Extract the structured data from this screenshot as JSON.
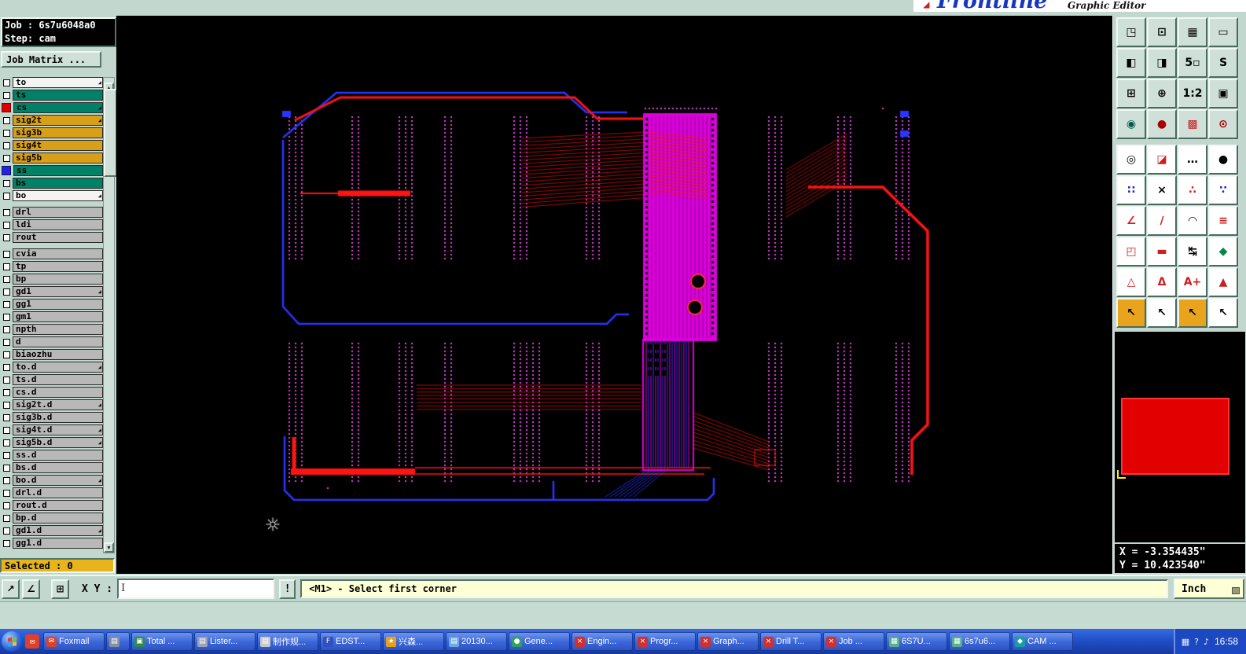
{
  "window": {
    "brand": "Frontline",
    "brand_sub": "Graphic Editor"
  },
  "job_panel": {
    "job_label": "Job : 6s7u6048a0",
    "step_label": "Step: cam",
    "matrix_button": "Job Matrix ..."
  },
  "layers": {
    "selected_label": "Selected : 0",
    "items": [
      {
        "name": "to",
        "color": "white",
        "arrow": true
      },
      {
        "name": "ts",
        "color": "teal"
      },
      {
        "name": "cs",
        "color": "teal",
        "indicator": "red",
        "arrow": true
      },
      {
        "name": "sig2t",
        "color": "gold",
        "arrow": true
      },
      {
        "name": "sig3b",
        "color": "gold"
      },
      {
        "name": "sig4t",
        "color": "gold"
      },
      {
        "name": "sig5b",
        "color": "gold"
      },
      {
        "name": "ss",
        "color": "teal",
        "indicator": "blue"
      },
      {
        "name": "bs",
        "color": "teal"
      },
      {
        "name": "bo",
        "color": "white",
        "arrow": true
      },
      {
        "name": "drl",
        "color": "gray",
        "gap": true
      },
      {
        "name": "ldi",
        "color": "gray"
      },
      {
        "name": "rout",
        "color": "gray"
      },
      {
        "name": "cvia",
        "color": "gray",
        "gap": true
      },
      {
        "name": "tp",
        "color": "gray"
      },
      {
        "name": "bp",
        "color": "gray"
      },
      {
        "name": "gd1",
        "color": "gray",
        "arrow": true
      },
      {
        "name": "gg1",
        "color": "gray"
      },
      {
        "name": "gm1",
        "color": "gray"
      },
      {
        "name": "npth",
        "color": "gray"
      },
      {
        "name": "d",
        "color": "gray"
      },
      {
        "name": "biaozhu",
        "color": "gray"
      },
      {
        "name": "to.d",
        "color": "gray",
        "arrow": true
      },
      {
        "name": "ts.d",
        "color": "gray"
      },
      {
        "name": "cs.d",
        "color": "gray"
      },
      {
        "name": "sig2t.d",
        "color": "gray",
        "arrow": true
      },
      {
        "name": "sig3b.d",
        "color": "gray"
      },
      {
        "name": "sig4t.d",
        "color": "gray",
        "arrow": true
      },
      {
        "name": "sig5b.d",
        "color": "gray",
        "arrow": true
      },
      {
        "name": "ss.d",
        "color": "gray"
      },
      {
        "name": "bs.d",
        "color": "gray"
      },
      {
        "name": "bo.d",
        "color": "gray",
        "arrow": true
      },
      {
        "name": "drl.d",
        "color": "gray"
      },
      {
        "name": "rout.d",
        "color": "gray"
      },
      {
        "name": "bp.d",
        "color": "gray"
      },
      {
        "name": "gd1.d",
        "color": "gray",
        "arrow": true
      },
      {
        "name": "gg1.d",
        "color": "gray"
      }
    ]
  },
  "toolbar": {
    "groups": [
      [
        {
          "name": "copy-to-window-icon",
          "glyph": "◳"
        },
        {
          "name": "screen-view-icon",
          "glyph": "⊡"
        },
        {
          "name": "keypad-icon",
          "glyph": "▦"
        },
        {
          "name": "wide-monitor-icon",
          "glyph": "▭"
        },
        {
          "name": "pan-left-window-icon",
          "glyph": "◧"
        },
        {
          "name": "pan-right-window-icon",
          "glyph": "◨"
        },
        {
          "name": "five-windows-icon",
          "glyph": "5▫"
        },
        {
          "name": "s-profile-icon",
          "glyph": "S"
        },
        {
          "name": "zoom-extents-icon",
          "glyph": "⊞"
        },
        {
          "name": "zoom-center-icon",
          "glyph": "⊕"
        },
        {
          "name": "scale-1-2-icon",
          "glyph": "1:2"
        },
        {
          "name": "clipboard-view-icon",
          "glyph": "▣"
        },
        {
          "name": "measure-tool-icon",
          "glyph": "◉",
          "color": "#055a50"
        },
        {
          "name": "highlight-tool-icon",
          "glyph": "●",
          "color": "#aa0000"
        },
        {
          "name": "layer-colors-icon",
          "glyph": "▩",
          "color": "#cc2020"
        },
        {
          "name": "net-probe-icon",
          "glyph": "⊙",
          "color": "#aa0000"
        }
      ],
      [
        {
          "name": "capture-circle-icon",
          "glyph": "◎",
          "bg": "#ffffff"
        },
        {
          "name": "corner-flip-icon",
          "glyph": "◪",
          "color": "#cc2020",
          "bg": "#ffffff"
        },
        {
          "name": "options-ellipsis-button",
          "glyph": "…",
          "bg": "#ffffff"
        },
        {
          "name": "dot-select-button",
          "glyph": "●",
          "bg": "#ffffff"
        },
        {
          "name": "red-blue-dots-icon",
          "glyph": "∷",
          "color": "#2020cc",
          "bg": "#ffffff"
        },
        {
          "name": "delete-x-icon",
          "glyph": "×",
          "bg": "#ffffff"
        },
        {
          "name": "red-pair-dots-icon",
          "glyph": "∴",
          "color": "#cc2020",
          "bg": "#ffffff"
        },
        {
          "name": "blue-pair-dots-icon",
          "glyph": "∵",
          "color": "#2020cc",
          "bg": "#ffffff"
        },
        {
          "name": "angle-ruler-icon",
          "glyph": "∠",
          "color": "#cc2020",
          "bg": "#ffffff"
        },
        {
          "name": "diagonal-line-icon",
          "glyph": "∕",
          "color": "#cc2020",
          "bg": "#ffffff"
        },
        {
          "name": "arc-tool-icon",
          "glyph": "◠",
          "bg": "#ffffff"
        },
        {
          "name": "trace-lines-icon",
          "glyph": "≡",
          "color": "#cc2020",
          "bg": "#ffffff"
        },
        {
          "name": "pad-corner-icon",
          "glyph": "◰",
          "color": "#cc2020",
          "bg": "#ffffff"
        },
        {
          "name": "short-dash-icon",
          "glyph": "▬",
          "color": "#cc2020",
          "bg": "#ffffff"
        },
        {
          "name": "width-measure-icon",
          "glyph": "↹",
          "bg": "#ffffff"
        },
        {
          "name": "shapes-tool-icon",
          "glyph": "◆",
          "color": "#008844",
          "bg": "#ffffff"
        },
        {
          "name": "triangle-outline-icon",
          "glyph": "△",
          "color": "#cc2020",
          "bg": "#ffffff"
        },
        {
          "name": "triangle-letter-icon",
          "glyph": "Δ",
          "color": "#cc2020",
          "bg": "#ffffff"
        },
        {
          "name": "text-add-icon",
          "glyph": "A+",
          "color": "#cc2020",
          "bg": "#ffffff"
        },
        {
          "name": "triangle-filled-icon",
          "glyph": "▲",
          "color": "#cc2020",
          "bg": "#ffffff"
        },
        {
          "name": "select-cursor-icon",
          "glyph": "↖",
          "bg": "#e8a41c"
        },
        {
          "name": "arrow-cursor-icon",
          "glyph": "↖",
          "bg": "#ffffff"
        },
        {
          "name": "box-cursor-icon",
          "glyph": "↖",
          "bg": "#e8a41c"
        },
        {
          "name": "dots-cursor-icon",
          "glyph": "↖",
          "bg": "#ffffff"
        }
      ]
    ]
  },
  "overview": {
    "x_readout": "X = -3.354435\"",
    "y_readout": "Y = 10.423540\""
  },
  "statusbar": {
    "tool_buttons": [
      {
        "name": "select-mode-button",
        "glyph": "↗"
      },
      {
        "name": "angle-mode-button",
        "glyph": "∠"
      },
      {
        "name": "grid-mode-button",
        "glyph": "⊞"
      }
    ],
    "xy_label": "X Y :",
    "xy_value": "",
    "alert_button": "!",
    "message": "<M1> - Select first corner",
    "units_button": "Inch"
  },
  "taskbar": {
    "clock": "16:58",
    "buttons": [
      {
        "label": "Foxmail",
        "icon": "✉",
        "icon_bg": "#e04028"
      },
      {
        "label": "",
        "icon": "▤",
        "icon_bg": "#8890a0",
        "narrow": true
      },
      {
        "label": "Total ...",
        "icon": "▣",
        "icon_bg": "#2c8c50"
      },
      {
        "label": "Lister...",
        "icon": "▤",
        "icon_bg": "#9aa2b4"
      },
      {
        "label": "制作规...",
        "icon": "▤",
        "icon_bg": "#c8c8c8"
      },
      {
        "label": "EDST...",
        "icon": "F",
        "icon_bg": "#3050c0"
      },
      {
        "label": "兴森...",
        "icon": "★",
        "icon_bg": "#e8a018"
      },
      {
        "label": "20130...",
        "icon": "▤",
        "icon_bg": "#70a8e0"
      },
      {
        "label": "Gene...",
        "icon": "●",
        "icon_bg": "#30a060"
      },
      {
        "label": "Engin...",
        "icon": "×",
        "icon_bg": "#d03030"
      },
      {
        "label": "Progr...",
        "icon": "×",
        "icon_bg": "#d03030"
      },
      {
        "label": "Graph...",
        "icon": "×",
        "icon_bg": "#d03030"
      },
      {
        "label": "Drill T...",
        "icon": "×",
        "icon_bg": "#d03030"
      },
      {
        "label": "Job ...",
        "icon": "×",
        "icon_bg": "#d03030"
      },
      {
        "label": "6S7U...",
        "icon": "▦",
        "icon_bg": "#58b088"
      },
      {
        "label": "6s7u6...",
        "icon": "▦",
        "icon_bg": "#58b088"
      },
      {
        "label": "CAM ...",
        "icon": "◆",
        "icon_bg": "#18a0a0"
      }
    ],
    "tray_icons": [
      {
        "name": "tray-display-icon",
        "glyph": "▦"
      },
      {
        "name": "tray-help-icon",
        "glyph": "?"
      },
      {
        "name": "tray-volume-icon",
        "glyph": "♪"
      }
    ]
  }
}
